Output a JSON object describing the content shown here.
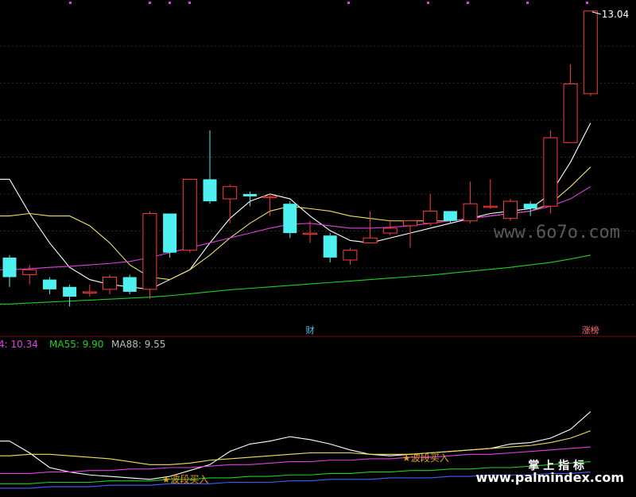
{
  "chart_data": [
    {
      "type": "candlestick",
      "title": "",
      "ylim": [
        6.6,
        13.2
      ],
      "grid": true,
      "max_label": "13.04",
      "event_labels": [
        {
          "index": 15,
          "text": "财",
          "color": "#4fc3f7"
        },
        {
          "index": 29,
          "text": "涨榜",
          "color": "#ff6b6b"
        }
      ],
      "candles": [
        {
          "o": 8.0,
          "c": 7.6,
          "h": 8.05,
          "l": 7.4
        },
        {
          "o": 7.65,
          "c": 7.75,
          "h": 7.85,
          "l": 7.45
        },
        {
          "o": 7.55,
          "c": 7.35,
          "h": 7.6,
          "l": 7.25
        },
        {
          "o": 7.4,
          "c": 7.2,
          "h": 7.45,
          "l": 7.0
        },
        {
          "o": 7.3,
          "c": 7.3,
          "h": 7.45,
          "l": 7.2
        },
        {
          "o": 7.35,
          "c": 7.6,
          "h": 7.65,
          "l": 7.25
        },
        {
          "o": 7.6,
          "c": 7.3,
          "h": 7.65,
          "l": 7.25
        },
        {
          "o": 7.35,
          "c": 8.9,
          "h": 8.95,
          "l": 7.15
        },
        {
          "o": 8.9,
          "c": 8.1,
          "h": 8.9,
          "l": 8.0
        },
        {
          "o": 8.15,
          "c": 9.6,
          "h": 9.6,
          "l": 8.1
        },
        {
          "o": 9.6,
          "c": 9.15,
          "h": 10.6,
          "l": 9.1
        },
        {
          "o": 9.2,
          "c": 9.45,
          "h": 9.5,
          "l": 8.7
        },
        {
          "o": 9.3,
          "c": 9.25,
          "h": 9.35,
          "l": 9.05
        },
        {
          "o": 9.25,
          "c": 9.25,
          "h": 9.3,
          "l": 8.85
        },
        {
          "o": 9.1,
          "c": 8.5,
          "h": 9.15,
          "l": 8.4
        },
        {
          "o": 8.5,
          "c": 8.5,
          "h": 8.75,
          "l": 8.3
        },
        {
          "o": 8.45,
          "c": 8.0,
          "h": 8.5,
          "l": 7.9
        },
        {
          "o": 7.95,
          "c": 8.15,
          "h": 8.2,
          "l": 7.85
        },
        {
          "o": 8.3,
          "c": 8.4,
          "h": 8.95,
          "l": 8.3
        },
        {
          "o": 8.5,
          "c": 8.6,
          "h": 8.75,
          "l": 8.45
        },
        {
          "o": 8.65,
          "c": 8.75,
          "h": 8.75,
          "l": 8.2
        },
        {
          "o": 8.7,
          "c": 8.95,
          "h": 9.3,
          "l": 8.65
        },
        {
          "o": 8.95,
          "c": 8.75,
          "h": 8.95,
          "l": 8.7
        },
        {
          "o": 8.75,
          "c": 9.1,
          "h": 9.55,
          "l": 8.7
        },
        {
          "o": 9.05,
          "c": 9.05,
          "h": 9.6,
          "l": 9.0
        },
        {
          "o": 8.8,
          "c": 9.15,
          "h": 9.2,
          "l": 8.75
        },
        {
          "o": 9.1,
          "c": 9.0,
          "h": 9.15,
          "l": 8.85
        },
        {
          "o": 9.05,
          "c": 10.45,
          "h": 10.6,
          "l": 8.9
        },
        {
          "o": 10.35,
          "c": 11.55,
          "h": 11.95,
          "l": 10.35
        },
        {
          "o": 11.35,
          "c": 13.04,
          "h": 13.04,
          "l": 11.3
        }
      ],
      "series": [
        {
          "name": "",
          "color": "#ffffff",
          "values": [
            9.6,
            8.9,
            8.3,
            7.8,
            7.55,
            7.45,
            7.4,
            7.35,
            7.55,
            7.75,
            8.3,
            8.8,
            9.15,
            9.3,
            9.2,
            8.85,
            8.55,
            8.35,
            8.3,
            8.4,
            8.5,
            8.6,
            8.7,
            8.8,
            8.9,
            8.95,
            9.0,
            9.3,
            9.95,
            10.75
          ]
        },
        {
          "name": "",
          "color": "#f0e060",
          "values": [
            8.85,
            8.9,
            8.85,
            8.85,
            8.65,
            8.3,
            7.85,
            7.6,
            7.55,
            7.75,
            8.05,
            8.4,
            8.7,
            8.95,
            9.05,
            9.0,
            8.95,
            8.85,
            8.8,
            8.75,
            8.75,
            8.75,
            8.75,
            8.8,
            8.85,
            8.9,
            8.95,
            9.1,
            9.45,
            9.85
          ]
        },
        {
          "name": "",
          "color": "#e040e0",
          "values": [
            7.75,
            7.77,
            7.8,
            7.82,
            7.85,
            7.88,
            7.92,
            8.0,
            8.1,
            8.2,
            8.3,
            8.4,
            8.5,
            8.6,
            8.68,
            8.7,
            8.65,
            8.6,
            8.6,
            8.62,
            8.65,
            8.7,
            8.75,
            8.8,
            8.85,
            8.9,
            8.95,
            9.05,
            9.2,
            9.45
          ]
        },
        {
          "name": "",
          "color": "#20d020",
          "values": [
            7.05,
            7.07,
            7.09,
            7.11,
            7.13,
            7.15,
            7.17,
            7.19,
            7.22,
            7.26,
            7.3,
            7.34,
            7.37,
            7.4,
            7.43,
            7.46,
            7.49,
            7.52,
            7.55,
            7.58,
            7.61,
            7.64,
            7.68,
            7.72,
            7.76,
            7.8,
            7.85,
            7.9,
            7.97,
            8.05
          ]
        }
      ]
    },
    {
      "type": "line",
      "title": "",
      "ylim": [
        0,
        100
      ],
      "legend": [
        {
          "text": "4: 10.34",
          "color": "#e040e0"
        },
        {
          "text": "MA55: 9.90",
          "color": "#20d020"
        },
        {
          "text": "MA88: 9.55",
          "color": "#bbbbbb"
        }
      ],
      "annotations": [
        {
          "index": 8,
          "text": "★波段买入",
          "color": "#e8a020"
        },
        {
          "index": 20,
          "text": "★波段买入",
          "color": "#e8a020"
        }
      ],
      "series": [
        {
          "name": "",
          "color": "#ffffff",
          "values": [
            38,
            30,
            20,
            17,
            15,
            14,
            13,
            12,
            14,
            18,
            22,
            31,
            36,
            38,
            41,
            39,
            36,
            32,
            29,
            28,
            29,
            30,
            31,
            32,
            33,
            36,
            37,
            40,
            46,
            58
          ]
        },
        {
          "name": "",
          "color": "#f0e060",
          "values": [
            28,
            29,
            29,
            28,
            27,
            26,
            24,
            22,
            22,
            23,
            25,
            26,
            27,
            28,
            29,
            30,
            30,
            30,
            29,
            29,
            29,
            30,
            31,
            32,
            33,
            34,
            35,
            37,
            40,
            45
          ]
        },
        {
          "name": "",
          "color": "#e040e0",
          "values": [
            16,
            16,
            17,
            17,
            18,
            18,
            19,
            19,
            20,
            20,
            21,
            22,
            22,
            23,
            24,
            24,
            25,
            25,
            26,
            26,
            27,
            27,
            28,
            29,
            29,
            30,
            31,
            32,
            33,
            34
          ]
        },
        {
          "name": "",
          "color": "#20d020",
          "values": [
            9,
            9,
            10,
            10,
            10,
            11,
            11,
            11,
            12,
            12,
            13,
            13,
            14,
            14,
            15,
            15,
            16,
            16,
            17,
            17,
            18,
            18,
            19,
            19,
            20,
            20,
            21,
            22,
            23,
            24
          ]
        },
        {
          "name": "",
          "color": "#4060ff",
          "values": [
            6,
            6,
            7,
            7,
            7,
            8,
            8,
            8,
            9,
            9,
            9,
            10,
            10,
            10,
            11,
            11,
            12,
            12,
            12,
            13,
            13,
            13,
            14,
            14,
            15,
            15,
            15,
            16,
            16,
            17
          ]
        }
      ]
    }
  ],
  "watermarks": {
    "mid": "www.6o7o.com",
    "brand": "掌 上 指 标",
    "url": "www.palmindex.com"
  },
  "colors": {
    "up": "#ff3b3b",
    "down": "#4ef0f0",
    "grid": "#2a2a2a",
    "panel_sep": "#7a1010"
  }
}
